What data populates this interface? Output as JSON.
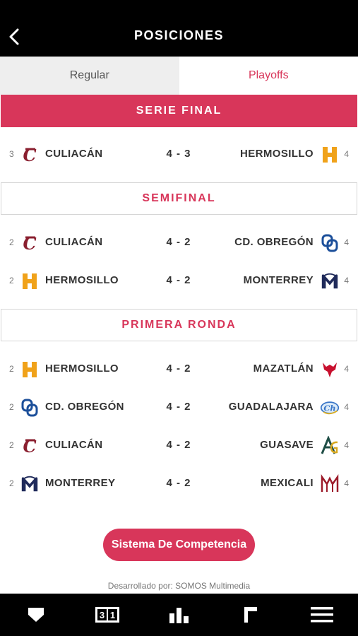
{
  "header": {
    "title": "POSICIONES",
    "back_icon": "chevron-left-icon"
  },
  "tabs": [
    {
      "label": "Regular",
      "active": false
    },
    {
      "label": "Playoffs",
      "active": true
    }
  ],
  "sections": [
    {
      "title": "SERIE FINAL",
      "matches": [
        {
          "left": {
            "wins": "3",
            "team": "CULIACÁN",
            "logo": "culiacan-logo"
          },
          "score": "4 - 3",
          "right": {
            "team": "HERMOSILLO",
            "wins": "4",
            "logo": "hermosillo-logo"
          }
        }
      ]
    },
    {
      "title": "SEMIFINAL",
      "matches": [
        {
          "left": {
            "wins": "2",
            "team": "CULIACÁN",
            "logo": "culiacan-logo"
          },
          "score": "4 - 2",
          "right": {
            "team": "CD. OBREGÓN",
            "wins": "4",
            "logo": "obregon-logo"
          }
        },
        {
          "left": {
            "wins": "2",
            "team": "HERMOSILLO",
            "logo": "hermosillo-logo"
          },
          "score": "4 - 2",
          "right": {
            "team": "MONTERREY",
            "wins": "4",
            "logo": "monterrey-logo"
          }
        }
      ]
    },
    {
      "title": "PRIMERA RONDA",
      "matches": [
        {
          "left": {
            "wins": "2",
            "team": "HERMOSILLO",
            "logo": "hermosillo-logo"
          },
          "score": "4 - 2",
          "right": {
            "team": "MAZATLÁN",
            "wins": "4",
            "logo": "mazatlan-logo"
          }
        },
        {
          "left": {
            "wins": "2",
            "team": "CD. OBREGÓN",
            "logo": "obregon-logo"
          },
          "score": "4 - 2",
          "right": {
            "team": "GUADALAJARA",
            "wins": "4",
            "logo": "guadalajara-logo"
          }
        },
        {
          "left": {
            "wins": "2",
            "team": "CULIACÁN",
            "logo": "culiacan-logo"
          },
          "score": "4 - 2",
          "right": {
            "team": "GUASAVE",
            "wins": "4",
            "logo": "guasave-logo"
          }
        },
        {
          "left": {
            "wins": "2",
            "team": "MONTERREY",
            "logo": "monterrey-logo"
          },
          "score": "4 - 2",
          "right": {
            "team": "MEXICALI",
            "wins": "4",
            "logo": "mexicali-logo"
          }
        }
      ]
    }
  ],
  "cta_label": "Sistema De Competencia",
  "credit": "Desarrollado por: SOMOS Multimedia",
  "bottom_nav": [
    {
      "icon": "home-plate-icon"
    },
    {
      "icon": "scoreboard-icon",
      "text": "31"
    },
    {
      "icon": "bar-chart-icon"
    },
    {
      "icon": "standings-flag-icon"
    },
    {
      "icon": "hamburger-menu-icon"
    }
  ],
  "colors": {
    "accent": "#d8365a",
    "dark": "#000000",
    "culiacan": "#8a1f2f",
    "hermosillo": "#f0a21a",
    "obregon": "#1c4f9a",
    "monterrey": "#1f2a5a",
    "mazatlan": "#c8102e",
    "guadalajara": "#3a76c8",
    "guasave": "#1f4e46",
    "mexicali": "#9c1b2a"
  }
}
